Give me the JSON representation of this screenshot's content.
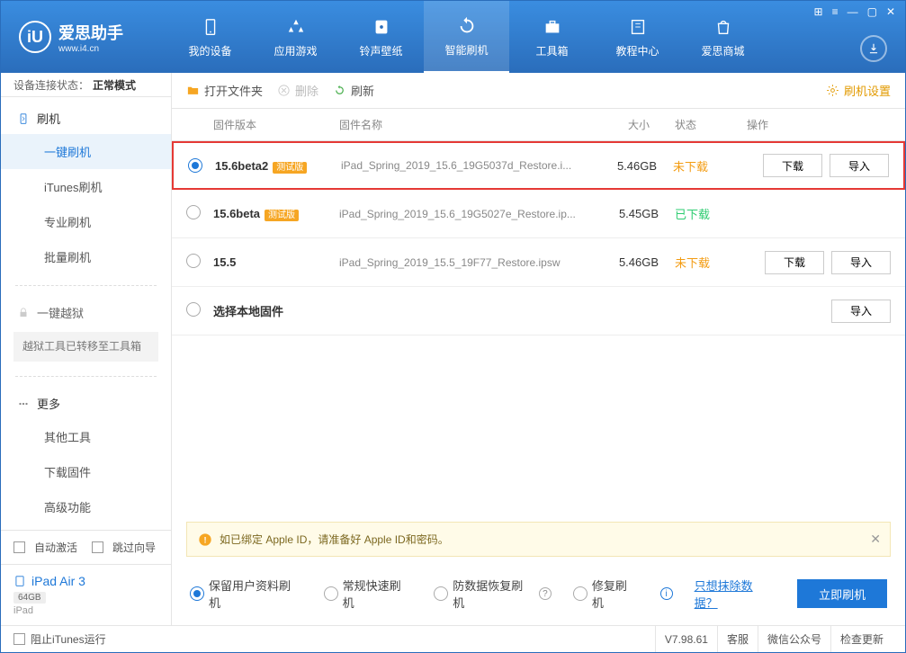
{
  "app": {
    "title": "爱思助手",
    "subtitle": "www.i4.cn"
  },
  "nav": [
    {
      "label": "我的设备"
    },
    {
      "label": "应用游戏"
    },
    {
      "label": "铃声壁纸"
    },
    {
      "label": "智能刷机"
    },
    {
      "label": "工具箱"
    },
    {
      "label": "教程中心"
    },
    {
      "label": "爱思商城"
    }
  ],
  "status": {
    "label": "设备连接状态：",
    "value": "正常模式"
  },
  "sidebar": {
    "flash": {
      "title": "刷机",
      "items": [
        "一键刷机",
        "iTunes刷机",
        "专业刷机",
        "批量刷机"
      ]
    },
    "jailbreak": {
      "title": "一键越狱",
      "transferred": "越狱工具已转移至工具箱"
    },
    "more": {
      "title": "更多",
      "items": [
        "其他工具",
        "下载固件",
        "高级功能"
      ]
    },
    "auto_activate": "自动激活",
    "skip_guide": "跳过向导",
    "device": {
      "name": "iPad Air 3",
      "storage": "64GB",
      "type": "iPad"
    }
  },
  "toolbar": {
    "open": "打开文件夹",
    "delete": "删除",
    "refresh": "刷新",
    "settings": "刷机设置"
  },
  "table": {
    "headers": {
      "version": "固件版本",
      "name": "固件名称",
      "size": "大小",
      "status": "状态",
      "action": "操作"
    },
    "rows": [
      {
        "version": "15.6beta2",
        "beta": "测试版",
        "name": "iPad_Spring_2019_15.6_19G5037d_Restore.i...",
        "size": "5.46GB",
        "status": "未下载",
        "status_class": "notdl",
        "download": "下载",
        "import": "导入",
        "checked": true,
        "highlighted": true
      },
      {
        "version": "15.6beta",
        "beta": "测试版",
        "name": "iPad_Spring_2019_15.6_19G5027e_Restore.ip...",
        "size": "5.45GB",
        "status": "已下载",
        "status_class": "dl"
      },
      {
        "version": "15.5",
        "name": "iPad_Spring_2019_15.5_19F77_Restore.ipsw",
        "size": "5.46GB",
        "status": "未下载",
        "status_class": "notdl",
        "download": "下载",
        "import": "导入"
      },
      {
        "version": "选择本地固件",
        "local": true,
        "import": "导入"
      }
    ]
  },
  "info": "如已绑定 Apple ID，请准备好 Apple ID和密码。",
  "options": {
    "o1": "保留用户资料刷机",
    "o2": "常规快速刷机",
    "o3": "防数据恢复刷机",
    "o4": "修复刷机",
    "link": "只想抹除数据？",
    "flash_btn": "立即刷机"
  },
  "footer": {
    "prevent_itunes": "阻止iTunes运行",
    "version": "V7.98.61",
    "service": "客服",
    "wechat": "微信公众号",
    "update": "检查更新"
  }
}
